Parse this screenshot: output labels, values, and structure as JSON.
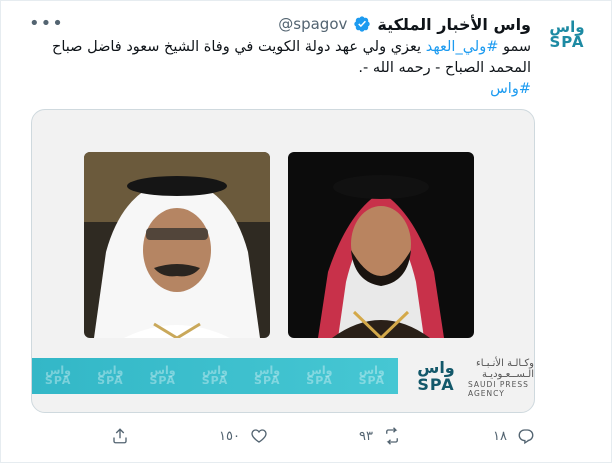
{
  "account": {
    "name": "واس الأخبار الملكية",
    "handle": "@spagov",
    "avatar_top": "واس",
    "avatar_bottom": "SPA"
  },
  "tweet": {
    "text_prefix": "سمو ",
    "hashtag_1": "#ولي_العهد",
    "text_main": " يعزي ولي عهد دولة الكويت في وفاة الشيخ سعود فاضل صباح المحمد الصباح - رحمه الله -.",
    "hashtag_2": "#واس"
  },
  "media": {
    "logo_top": "واس",
    "logo_bottom": "SPA",
    "agency_ar_1": "وكـالـة الأنـبـاء",
    "agency_ar_2": "الـســعـوديـة",
    "agency_en_1": "SAUDI PRESS",
    "agency_en_2": "AGENCY",
    "banner_pattern": "واس SPA"
  },
  "actions": {
    "reply_count": "١٨",
    "retweet_count": "٩٣",
    "like_count": "١٥٠"
  },
  "colors": {
    "accent": "#1d9bf0",
    "verified": "#1d9bf0",
    "banner": "#3cbfcd",
    "brand": "#1d8aa3"
  },
  "icons": {
    "more": "more-icon",
    "verified": "verified-badge-icon",
    "reply": "reply-icon",
    "retweet": "retweet-icon",
    "like": "heart-icon",
    "share": "share-icon"
  }
}
